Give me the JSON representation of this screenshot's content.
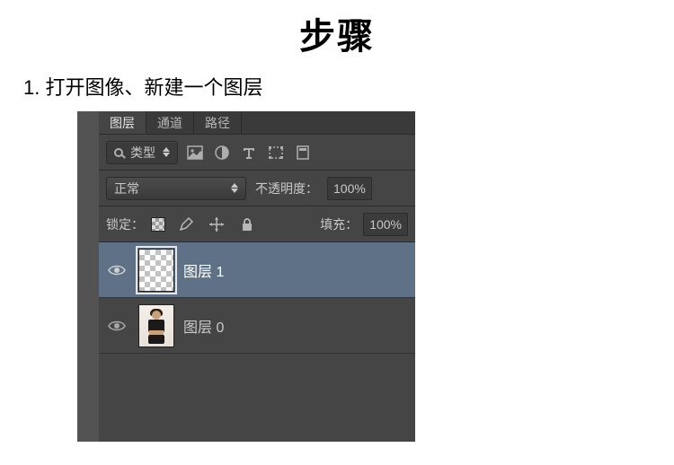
{
  "title": "步骤",
  "step1": "1. 打开图像、新建一个图层",
  "panel": {
    "tabs": {
      "layers": "图层",
      "channels": "通道",
      "paths": "路径"
    },
    "filter": {
      "kind_label": "类型"
    },
    "blend": {
      "mode": "正常",
      "opacity_label": "不透明度：",
      "opacity_value": "100%"
    },
    "lock": {
      "label": "锁定：",
      "fill_label": "填充：",
      "fill_value": "100%"
    },
    "layers": [
      {
        "name": "图层 1"
      },
      {
        "name": "图层 0"
      }
    ]
  }
}
